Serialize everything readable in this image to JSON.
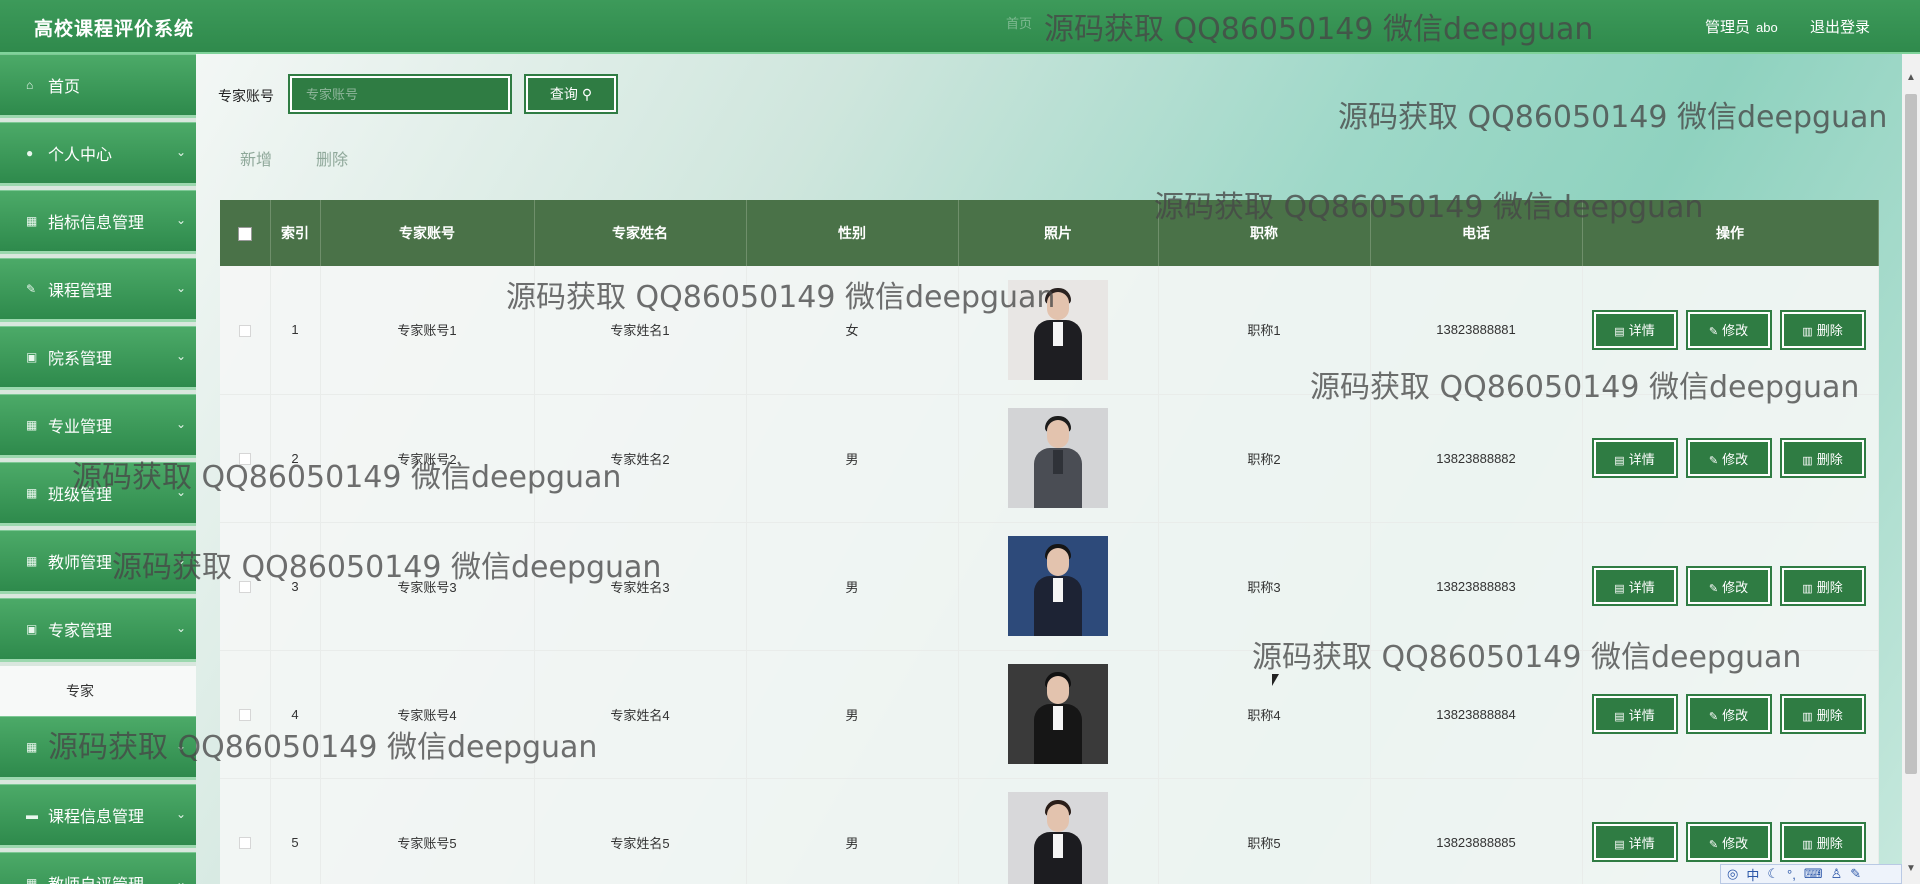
{
  "header": {
    "title": "高校课程评价系统",
    "faint_text": "首页",
    "admin_label": "管理员",
    "admin_name": "abo",
    "logout_label": "退出登录"
  },
  "sidebar": {
    "items": [
      {
        "label": "首页",
        "icon": "home-icon"
      },
      {
        "label": "个人中心",
        "icon": "user-icon"
      },
      {
        "label": "指标信息管理",
        "icon": "grid-icon"
      },
      {
        "label": "课程管理",
        "icon": "edit-icon"
      },
      {
        "label": "院系管理",
        "icon": "clipboard-icon"
      },
      {
        "label": "专业管理",
        "icon": "grid-icon"
      },
      {
        "label": "班级管理",
        "icon": "grid-icon"
      },
      {
        "label": "教师管理",
        "icon": "grid-icon"
      },
      {
        "label": "专家管理",
        "icon": "clipboard-icon"
      },
      {
        "label": "",
        "icon": "grid-icon"
      },
      {
        "label": "课程信息管理",
        "icon": "monitor-icon"
      },
      {
        "label": "教师自评管理",
        "icon": "grid-icon"
      }
    ],
    "submenu_label": "专家"
  },
  "search": {
    "label": "专家账号",
    "placeholder": "专家账号",
    "button_label": "查询",
    "button_icon": "search-icon"
  },
  "actions": {
    "add_label": "新增",
    "delete_label": "删除"
  },
  "table": {
    "headers": [
      "索引",
      "专家账号",
      "专家姓名",
      "性别",
      "照片",
      "职称",
      "电话",
      "操作"
    ],
    "rows": [
      {
        "index": "1",
        "account": "专家账号1",
        "name": "专家姓名1",
        "gender": "女",
        "title": "职称1",
        "phone": "13823888881"
      },
      {
        "index": "2",
        "account": "专家账号2",
        "name": "专家姓名2",
        "gender": "男",
        "title": "职称2",
        "phone": "13823888882"
      },
      {
        "index": "3",
        "account": "专家账号3",
        "name": "专家姓名3",
        "gender": "男",
        "title": "职称3",
        "phone": "13823888883"
      },
      {
        "index": "4",
        "account": "专家账号4",
        "name": "专家姓名4",
        "gender": "男",
        "title": "职称4",
        "phone": "13823888884"
      },
      {
        "index": "5",
        "account": "专家账号5",
        "name": "专家姓名5",
        "gender": "男",
        "title": "职称5",
        "phone": "13823888885"
      }
    ],
    "buttons": {
      "detail": "详情",
      "edit": "修改",
      "delete": "删除"
    }
  },
  "watermark_text": "源码获取 QQ86050149 微信deepguan",
  "ime": {
    "lang": "中"
  },
  "colors": {
    "primary_green": "#2f7c43",
    "header_green": "#3d9a5a",
    "table_head": "#4a7248"
  }
}
